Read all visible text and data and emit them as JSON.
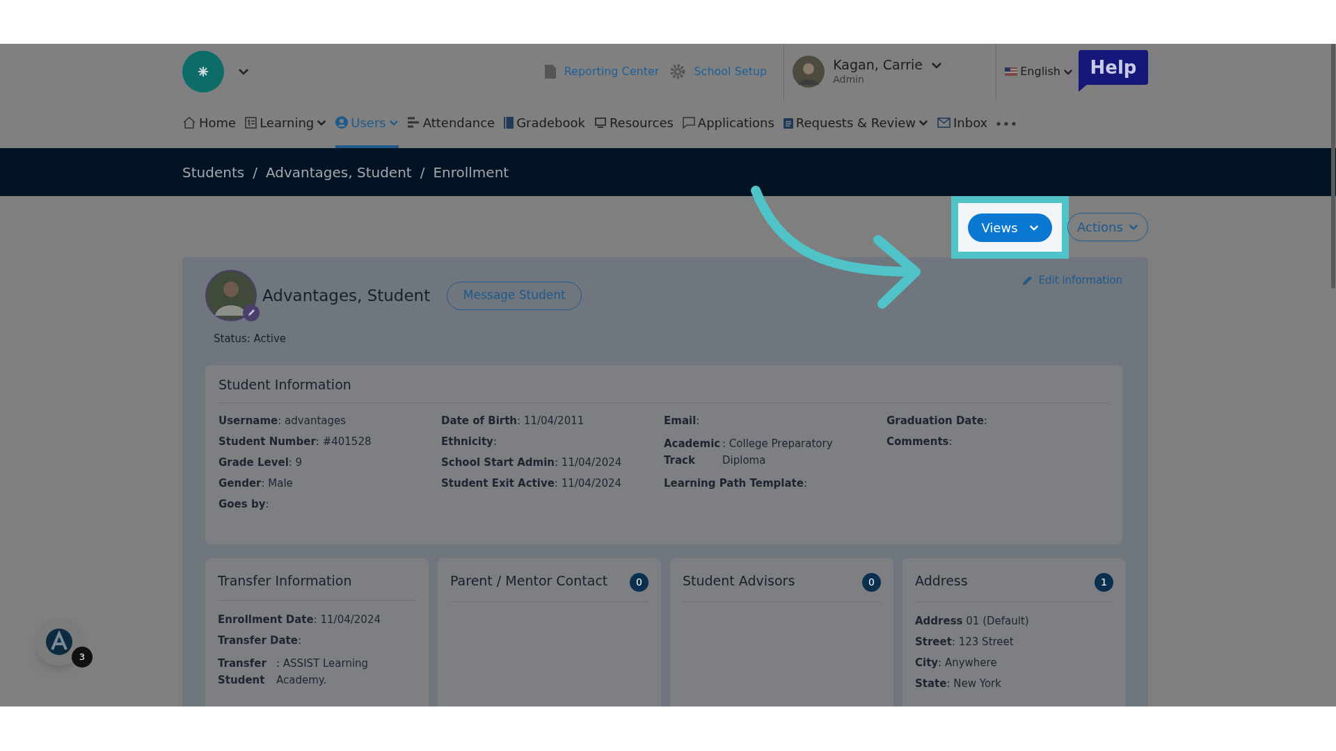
{
  "header": {
    "links": [
      {
        "label": "Reporting Center"
      },
      {
        "label": "School Setup"
      }
    ],
    "user": {
      "name": "Kagan, Carrie",
      "role": "Admin"
    },
    "language": "English",
    "help": "Help"
  },
  "nav": [
    {
      "label": "Home",
      "dropdown": false,
      "selected": false
    },
    {
      "label": "Learning",
      "dropdown": true,
      "selected": false
    },
    {
      "label": "Users",
      "dropdown": true,
      "selected": true
    },
    {
      "label": "Attendance",
      "dropdown": false,
      "selected": false
    },
    {
      "label": "Gradebook",
      "dropdown": false,
      "selected": false
    },
    {
      "label": "Resources",
      "dropdown": false,
      "selected": false
    },
    {
      "label": "Applications",
      "dropdown": false,
      "selected": false
    },
    {
      "label": "Requests & Review",
      "dropdown": true,
      "selected": false
    },
    {
      "label": "Inbox",
      "dropdown": false,
      "selected": false
    }
  ],
  "breadcrumb": {
    "links": [
      "Students",
      "Advantages, Student",
      "Enrollment"
    ],
    "separators": [
      "/",
      "/"
    ]
  },
  "toolbar": {
    "views": "Views",
    "actions": "Actions"
  },
  "student": {
    "name": "Advantages, Student",
    "message_button": "Message Student",
    "edit": "Edit information",
    "status": "Status: Active"
  },
  "student_information": {
    "title": "Student Information",
    "columns": [
      [
        {
          "kind": "line",
          "text": "**Username**: advantages"
        },
        {
          "kind": "line",
          "text": "**Student Number**: #401528"
        },
        {
          "kind": "line",
          "text": "**Grade Level**: 9"
        },
        {
          "kind": "line",
          "text": "**Gender**: Male"
        },
        {
          "kind": "line",
          "text": "**Goes by**:"
        }
      ],
      [
        {
          "kind": "line",
          "text": "**Date of Birth**: 11/04/2011"
        },
        {
          "kind": "line",
          "text": "**Ethnicity**:"
        },
        {
          "kind": "line",
          "text": "**School Start Admin**: 11/04/2024"
        },
        {
          "kind": "line",
          "text": "**Student Exit Active**: 11/04/2024"
        }
      ],
      [
        {
          "kind": "line",
          "text": "**Email**:"
        },
        {
          "kind": "split",
          "label": "Academic Track",
          "value": ": College Preparatory Diploma"
        },
        {
          "kind": "line",
          "text": "**Learning Path Template**:"
        }
      ],
      [
        {
          "kind": "line",
          "text": "**Graduation Date**:"
        },
        {
          "kind": "line",
          "text": "**Comments**:"
        }
      ]
    ]
  },
  "cards": [
    {
      "title": "Transfer Information",
      "fields": [
        {
          "kind": "line",
          "text": "**Enrollment Date**: 11/04/2024"
        },
        {
          "kind": "line",
          "text": "**Transfer Date**:"
        },
        {
          "kind": "split",
          "label": "Transfer Student",
          "value": ": ASSIST Learning Academy."
        }
      ]
    },
    {
      "title": "Parent / Mentor Contact",
      "count": "0"
    },
    {
      "title": "Student Advisors",
      "count": "0"
    },
    {
      "title": "Address",
      "count": "1",
      "fields": [
        {
          "kind": "line",
          "text": "**Address** 01 (Default)"
        },
        {
          "kind": "line",
          "text": "**Street**: 123 Street"
        },
        {
          "kind": "line",
          "text": "**City**: Anywhere"
        },
        {
          "kind": "line",
          "text": "**State**: New York"
        }
      ]
    }
  ],
  "assistant": {
    "count": "3"
  }
}
